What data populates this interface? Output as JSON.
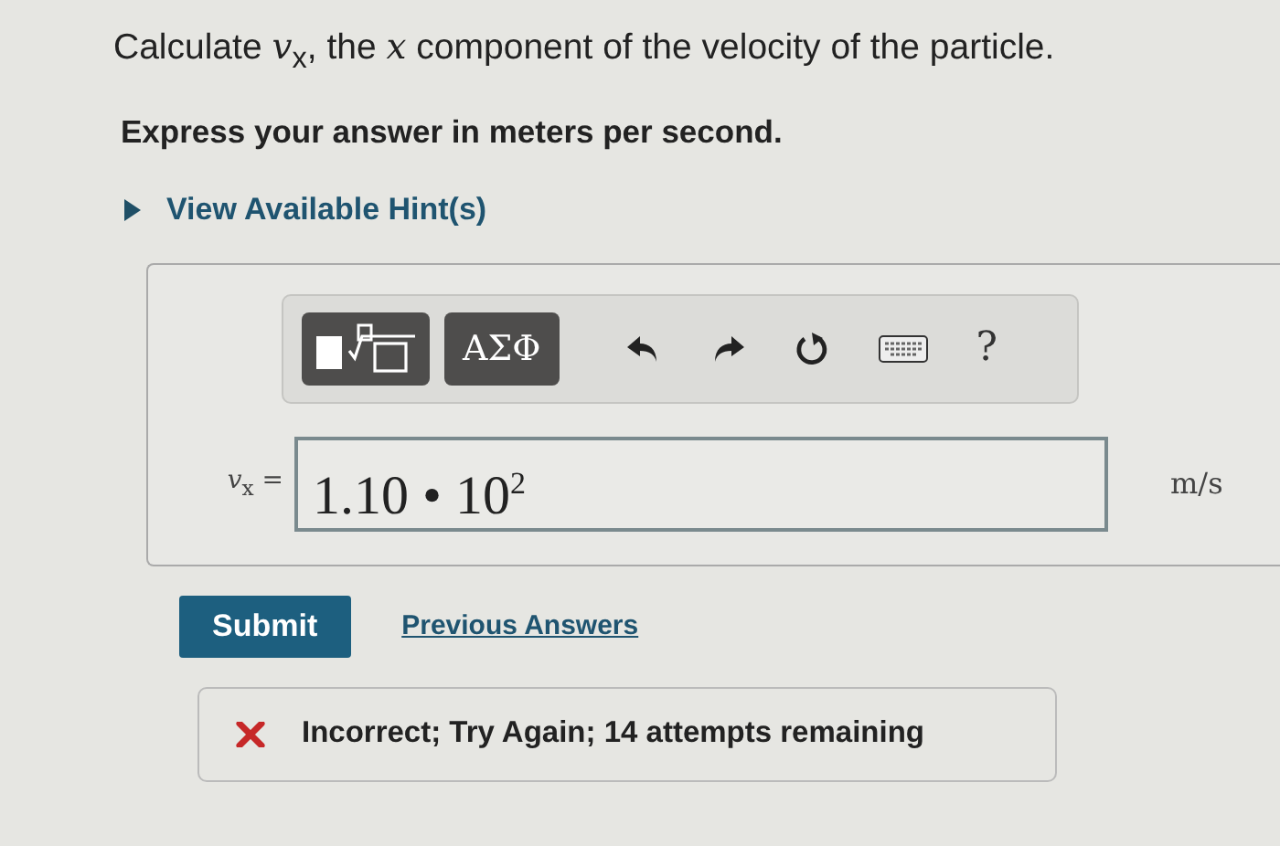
{
  "question": "Calculate *v*$_{x}$, the *x* component of the velocity of the particle.",
  "instruction": "Express your answer in meters per second.",
  "hint_toggle": {
    "label": "View Available Hint(s)",
    "expanded": false
  },
  "toolbar": [
    {
      "kind": "templates"
    },
    {
      "kind": "symbols",
      "label": "ΑΣΦ"
    },
    {
      "kind": "undo"
    },
    {
      "kind": "redo"
    },
    {
      "kind": "reset"
    },
    {
      "kind": "keyboard"
    },
    {
      "kind": "help",
      "label": "?"
    }
  ],
  "answer": {
    "label": "*v*$_{x}$ =",
    "value": "1.10 • 10$^{2}$",
    "unit": "m/s"
  },
  "submit": "Submit",
  "previous_answers": "Previous Answers",
  "feedback": {
    "kind": "incorrect",
    "message": "Incorrect; Try Again; 14 attempts remaining"
  }
}
